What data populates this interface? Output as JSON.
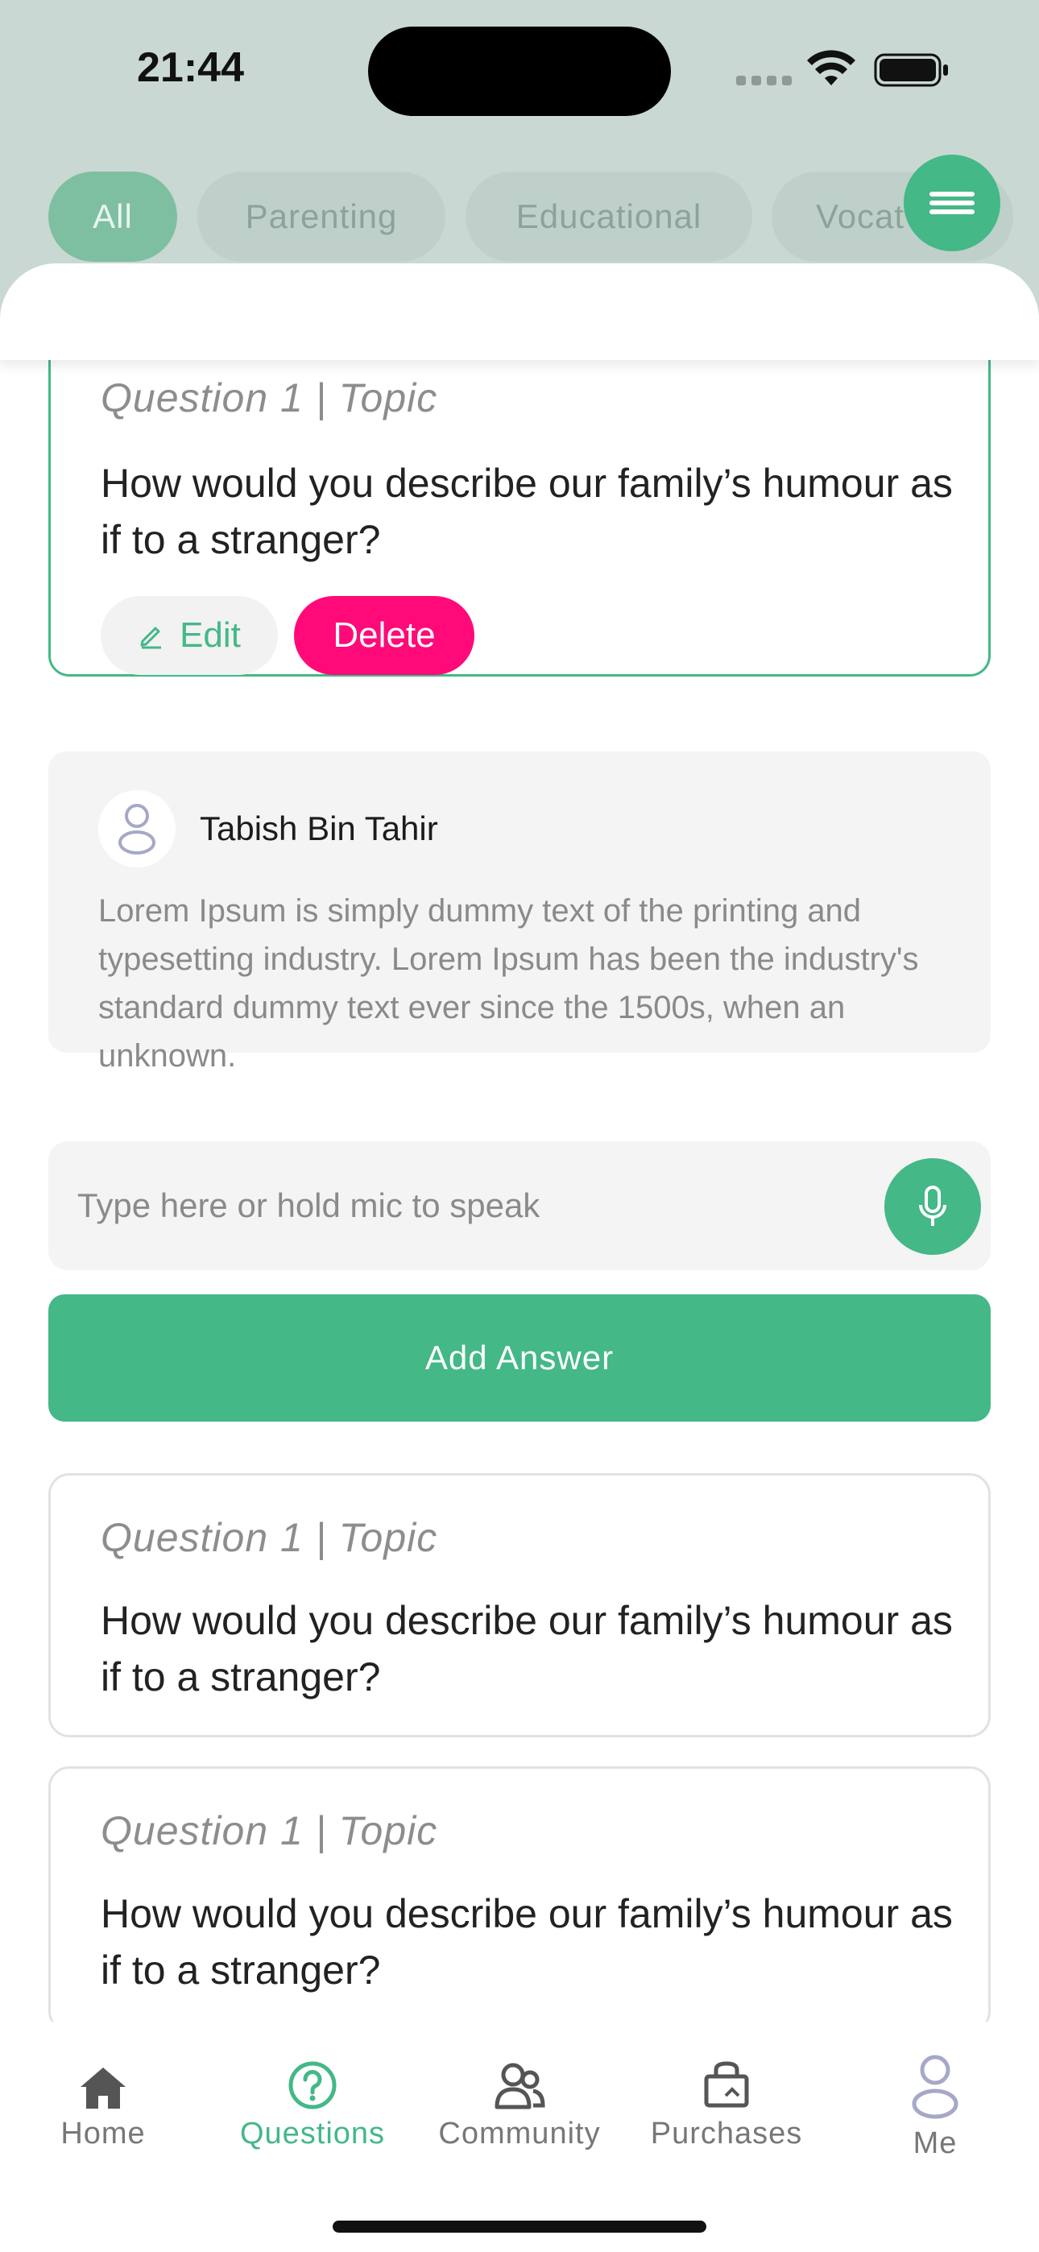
{
  "status_bar": {
    "time": "21:44"
  },
  "filters": {
    "chips": [
      {
        "label": "All",
        "active": true
      },
      {
        "label": "Parenting",
        "active": false
      },
      {
        "label": "Educational",
        "active": false
      },
      {
        "label": "Vocat",
        "active": false
      }
    ]
  },
  "selected_question": {
    "topic": "Question 1 | Topic",
    "text": "How would you describe our family’s humour as if to a stranger?",
    "edit_label": "Edit",
    "delete_label": "Delete"
  },
  "comment": {
    "author": "Tabish Bin Tahir",
    "body": "Lorem Ipsum is simply dummy text of the printing and typesetting industry. Lorem Ipsum has been the industry's standard dummy text ever since the 1500s, when an unknown."
  },
  "answer": {
    "placeholder": "Type here or hold mic to speak",
    "button_label": "Add Answer"
  },
  "questions": [
    {
      "topic": "Question 1 | Topic",
      "text": "How would you describe our family’s humour as if to a stranger?"
    },
    {
      "topic": "Question 1 | Topic",
      "text": "How would you describe our family’s humour as if to a stranger?"
    }
  ],
  "tabbar": {
    "active": "Questions",
    "items": [
      {
        "label": "Home",
        "icon": "home-icon"
      },
      {
        "label": "Questions",
        "icon": "question-icon"
      },
      {
        "label": "Community",
        "icon": "community-icon"
      },
      {
        "label": "Purchases",
        "icon": "purchases-icon"
      },
      {
        "label": "Me",
        "icon": "person-icon"
      }
    ]
  },
  "colors": {
    "accent": "#44b887",
    "delete": "#ff0a78",
    "header_bg": "#c9d8d3"
  }
}
